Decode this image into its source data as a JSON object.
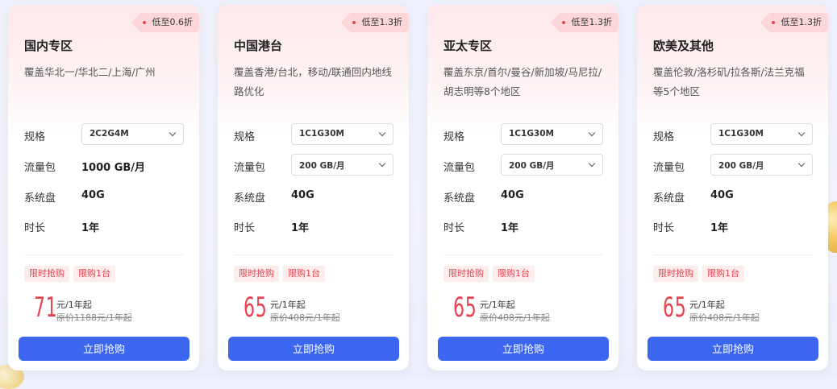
{
  "cards": [
    {
      "badge": "低至0.6折",
      "title": "国内专区",
      "description": "覆盖华北一/华北二/上海/广州",
      "spec_label": "规格",
      "spec_value": "2C2G4M",
      "traffic_label": "流量包",
      "traffic_value": "1000 GB/月",
      "traffic_is_select": false,
      "disk_label": "系统盘",
      "disk_value": "40G",
      "duration_label": "时长",
      "duration_value": "1年",
      "tag1": "限时抢购",
      "tag2": "限购1台",
      "price": "71",
      "price_unit": "元/1年起",
      "original_price": "原价1188元/1年起",
      "buy_label": "立即抢购"
    },
    {
      "badge": "低至1.3折",
      "title": "中国港台",
      "description": "覆盖香港/台北，移动/联通回内地线路优化",
      "spec_label": "规格",
      "spec_value": "1C1G30M",
      "traffic_label": "流量包",
      "traffic_value": "200 GB/月",
      "traffic_is_select": true,
      "disk_label": "系统盘",
      "disk_value": "40G",
      "duration_label": "时长",
      "duration_value": "1年",
      "tag1": "限时抢购",
      "tag2": "限购1台",
      "price": "65",
      "price_unit": "元/1年起",
      "original_price": "原价408元/1年起",
      "buy_label": "立即抢购"
    },
    {
      "badge": "低至1.3折",
      "title": "亚太专区",
      "description": "覆盖东京/首尔/曼谷/新加坡/马尼拉/胡志明等8个地区",
      "spec_label": "规格",
      "spec_value": "1C1G30M",
      "traffic_label": "流量包",
      "traffic_value": "200 GB/月",
      "traffic_is_select": true,
      "disk_label": "系统盘",
      "disk_value": "40G",
      "duration_label": "时长",
      "duration_value": "1年",
      "tag1": "限时抢购",
      "tag2": "限购1台",
      "price": "65",
      "price_unit": "元/1年起",
      "original_price": "原价408元/1年起",
      "buy_label": "立即抢购"
    },
    {
      "badge": "低至1.3折",
      "title": "欧美及其他",
      "description": "覆盖伦敦/洛杉矶/拉各斯/法兰克福等5个地区",
      "spec_label": "规格",
      "spec_value": "1C1G30M",
      "traffic_label": "流量包",
      "traffic_value": "200 GB/月",
      "traffic_is_select": true,
      "disk_label": "系统盘",
      "disk_value": "40G",
      "duration_label": "时长",
      "duration_value": "1年",
      "tag1": "限时抢购",
      "tag2": "限购1台",
      "price": "65",
      "price_unit": "元/1年起",
      "original_price": "原价408元/1年起",
      "buy_label": "立即抢购"
    }
  ],
  "colors": {
    "accent_red": "#e4434f",
    "button_blue": "#3d66f0",
    "badge_bg": "#fcd6d8"
  }
}
